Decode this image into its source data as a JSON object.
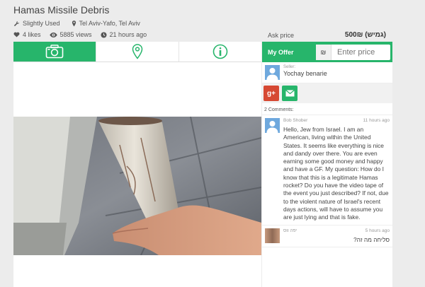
{
  "listing": {
    "title": "Hamas Missile Debris",
    "condition": "Slightly Used",
    "location": "Tel Aviv-Yafo, Tel Aviv",
    "likes": "4 likes",
    "views": "5885 views",
    "posted": "21 hours ago",
    "ask_label": "Ask price",
    "ask_price": "500₪ (גמיש)"
  },
  "tabs": [
    {
      "icon": "camera-icon",
      "active": true
    },
    {
      "icon": "map-pin-icon",
      "active": false
    },
    {
      "icon": "info-icon",
      "active": false
    }
  ],
  "offer": {
    "label": "My Offer",
    "currency": "₪",
    "placeholder": "Enter price"
  },
  "seller": {
    "label": "Seller:",
    "name": "Yochay benarie"
  },
  "share": {
    "gplus": "g+"
  },
  "comments_count": "2 Comments:",
  "comments": [
    {
      "author": "Bob Shober",
      "time": "11 hours ago",
      "text": "Hello, Jew from Israel. I am an American, living within the United States. It seems like everything is nice and dandy over there. You are even earning some good money and happy and have a GF. My question: How do I know that this is a legitimate Hamas rocket? Do you have the video tape of the event you just described? If not, due to the violent nature of Israel's recent days actions, will have to assume you are just lying and that is fake."
    },
    {
      "author": "יפה ווס",
      "time": "5 hours ago",
      "text": "סליחה מה זה?"
    }
  ],
  "colors": {
    "accent": "#27b56b",
    "background": "#ececec",
    "gplus": "#d64933"
  }
}
